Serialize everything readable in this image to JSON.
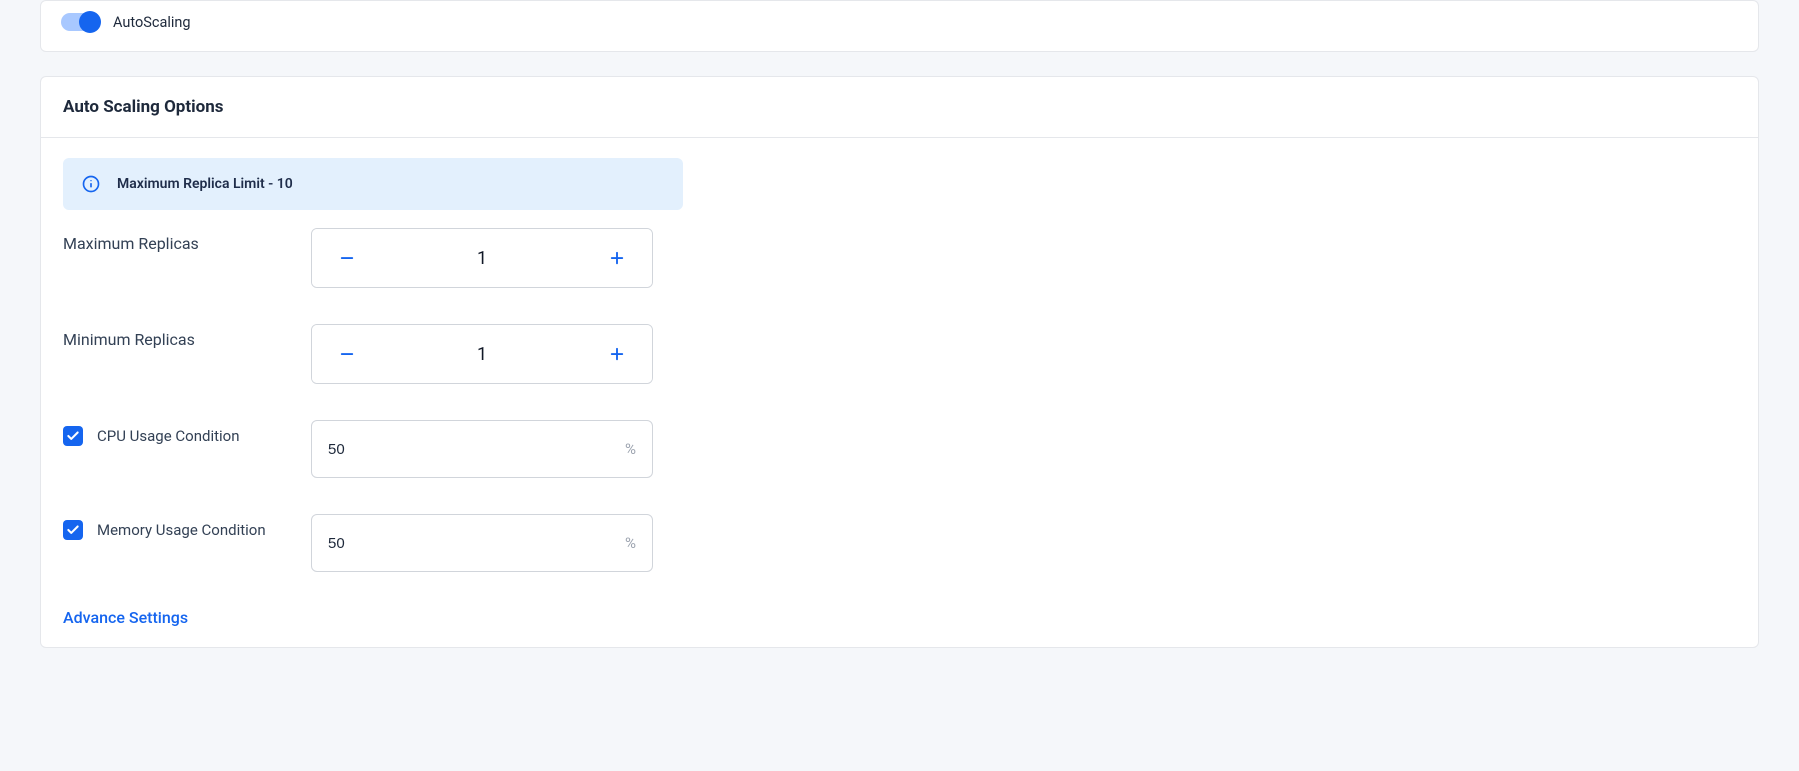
{
  "autoscaling_toggle": {
    "label": "AutoScaling",
    "enabled": true
  },
  "options": {
    "title": "Auto Scaling Options",
    "info_banner": "Maximum Replica Limit - 10",
    "max_replicas": {
      "label": "Maximum Replicas",
      "value": "1"
    },
    "min_replicas": {
      "label": "Minimum Replicas",
      "value": "1"
    },
    "cpu_condition": {
      "label": "CPU Usage Condition",
      "checked": true,
      "value": "50",
      "suffix": "%"
    },
    "memory_condition": {
      "label": "Memory Usage Condition",
      "checked": true,
      "value": "50",
      "suffix": "%"
    },
    "advance_settings": "Advance Settings"
  }
}
